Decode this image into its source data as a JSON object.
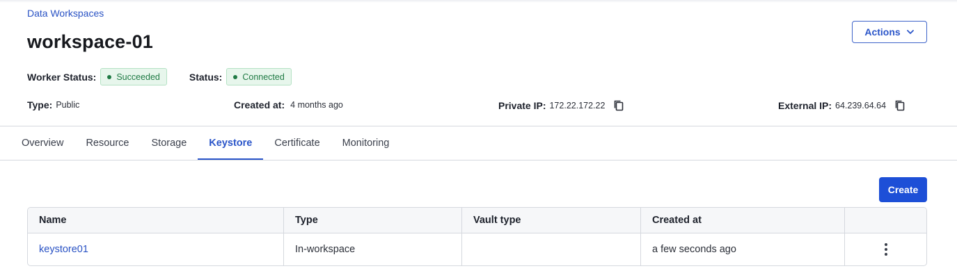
{
  "breadcrumb": {
    "label": "Data Workspaces"
  },
  "header": {
    "title": "workspace-01",
    "actions_label": "Actions",
    "actions_icon": "chevron-down-icon"
  },
  "status": {
    "worker_status_label": "Worker Status:",
    "worker_status_value": "Succeeded",
    "status_label": "Status:",
    "status_value": "Connected",
    "badge_color": "#1f7a44",
    "badge_bg": "#e7f6ec"
  },
  "meta": {
    "type_label": "Type:",
    "type_value": "Public",
    "created_label": "Created at:",
    "created_value": "4 months ago",
    "private_ip_label": "Private IP:",
    "private_ip_value": "172.22.172.22",
    "external_ip_label": "External IP:",
    "external_ip_value": "64.239.64.64",
    "copy_icon": "copy-icon"
  },
  "tabs": [
    {
      "label": "Overview",
      "active": false
    },
    {
      "label": "Resource",
      "active": false
    },
    {
      "label": "Storage",
      "active": false
    },
    {
      "label": "Keystore",
      "active": true
    },
    {
      "label": "Certificate",
      "active": false
    },
    {
      "label": "Monitoring",
      "active": false
    }
  ],
  "keystore": {
    "create_label": "Create",
    "columns": [
      "Name",
      "Type",
      "Vault type",
      "Created at",
      ""
    ],
    "rows": [
      {
        "name": "keystore01",
        "type": "In-workspace",
        "vault_type": "",
        "created_at": "a few seconds ago",
        "menu_icon": "kebab-menu-icon"
      }
    ]
  },
  "colors": {
    "accent": "#2a55c9",
    "primary_button": "#1d4fd7",
    "border": "#d5d8de"
  }
}
